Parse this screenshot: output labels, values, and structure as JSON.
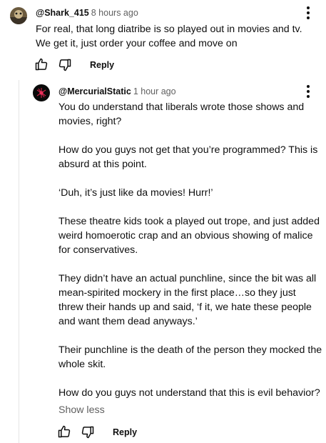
{
  "comment": {
    "handle": "@Shark_415",
    "time": "8 hours ago",
    "text": "For real, that long diatribe is so played out in movies and tv. We get it, just order your coffee and move on",
    "reply_label": "Reply"
  },
  "reply": {
    "handle": "@MercurialStatic",
    "time": "1 hour ago",
    "paragraphs": [
      "You do understand that liberals wrote those shows and movies, right?",
      "How do you guys not get that you’re programmed? This is absurd at this point.",
      "‘Duh, it’s just like da movies! Hurr!’",
      "These theatre kids took a played out trope, and just added weird homoerotic crap and an obvious showing of malice for conservatives.",
      "They didn’t have an actual punchline, since the bit was all mean-spirited mockery in the first place…so they just threw their hands up and said, ‘f it, we hate these people and want them dead anyways.’",
      "Their punchline is the death of the person they mocked the whole skit.",
      "How do you guys not understand that this is evil behavior?"
    ],
    "show_less_label": "Show less",
    "reply_label": "Reply"
  },
  "icons": {
    "more": "more-vertical-icon",
    "like": "thumbs-up-icon",
    "dislike": "thumbs-down-icon"
  }
}
